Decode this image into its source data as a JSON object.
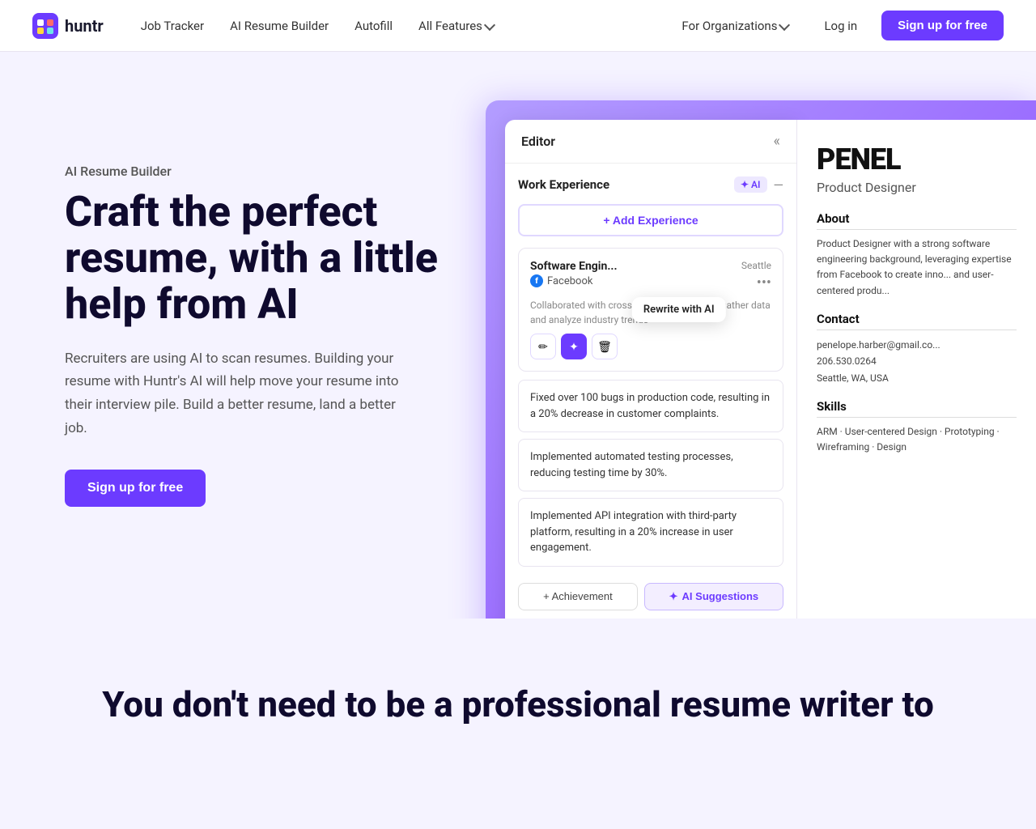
{
  "nav": {
    "logo_text": "huntr",
    "links": [
      {
        "label": "Job Tracker",
        "id": "job-tracker"
      },
      {
        "label": "AI Resume Builder",
        "id": "ai-resume-builder"
      },
      {
        "label": "Autofill",
        "id": "autofill"
      },
      {
        "label": "All Features",
        "id": "all-features",
        "has_dropdown": true
      },
      {
        "label": "For Organizations",
        "id": "for-organizations",
        "has_dropdown": true
      }
    ],
    "login_label": "Log in",
    "signup_label": "Sign up for free"
  },
  "hero": {
    "subtitle": "AI Resume Builder",
    "title": "Craft the perfect resume, with a little help from AI",
    "description": "Recruiters are using AI to scan resumes. Building your resume with Huntr's AI will help move your resume into their interview pile. Build a better resume, land a better job.",
    "cta_label": "Sign up for free"
  },
  "editor": {
    "title": "Editor",
    "section_title": "Work Experience",
    "ai_label": "AI",
    "add_exp_label": "+ Add Experience",
    "exp_title": "Software Engin...",
    "exp_company": "Facebook",
    "exp_location": "Seattle",
    "rewrite_label": "Rewrite with AI",
    "exp_desc": "Collaborated with cross-functional teams to gather data and analyze industry trends",
    "bullet1": "Fixed over 100 bugs in production code, resulting in a 20% decrease in customer complaints.",
    "bullet2": "Implemented automated testing processes, reducing testing time by 30%.",
    "bullet3": "Implemented API integration with third-party platform, resulting in a 20% increase in user engagement.",
    "achievement_btn": "+ Achievement",
    "ai_suggest_btn": "AI Suggestions"
  },
  "resume": {
    "name": "PENEL",
    "role": "Product Designer",
    "about_title": "About",
    "about_text": "Product Designer with a strong software engineering background, leveraging expertise from Facebook to create inno... and user-centered produ...",
    "contact_title": "Contact",
    "email": "penelope.harber@gmail.co...",
    "phone": "206.530.0264",
    "address": "Seattle, WA, USA",
    "skills_title": "Skills",
    "skills_text": "ARM · User-centered Design · Prototyping · Wireframing · Design"
  },
  "bottom": {
    "title": "You don't need to be a professional resume writer to"
  },
  "icons": {
    "collapse": "«",
    "minus": "—",
    "star": "✦",
    "pencil": "✏",
    "sparkle": "✦",
    "trash": "🗑",
    "dots": "•••",
    "chevron_down": "▾"
  }
}
